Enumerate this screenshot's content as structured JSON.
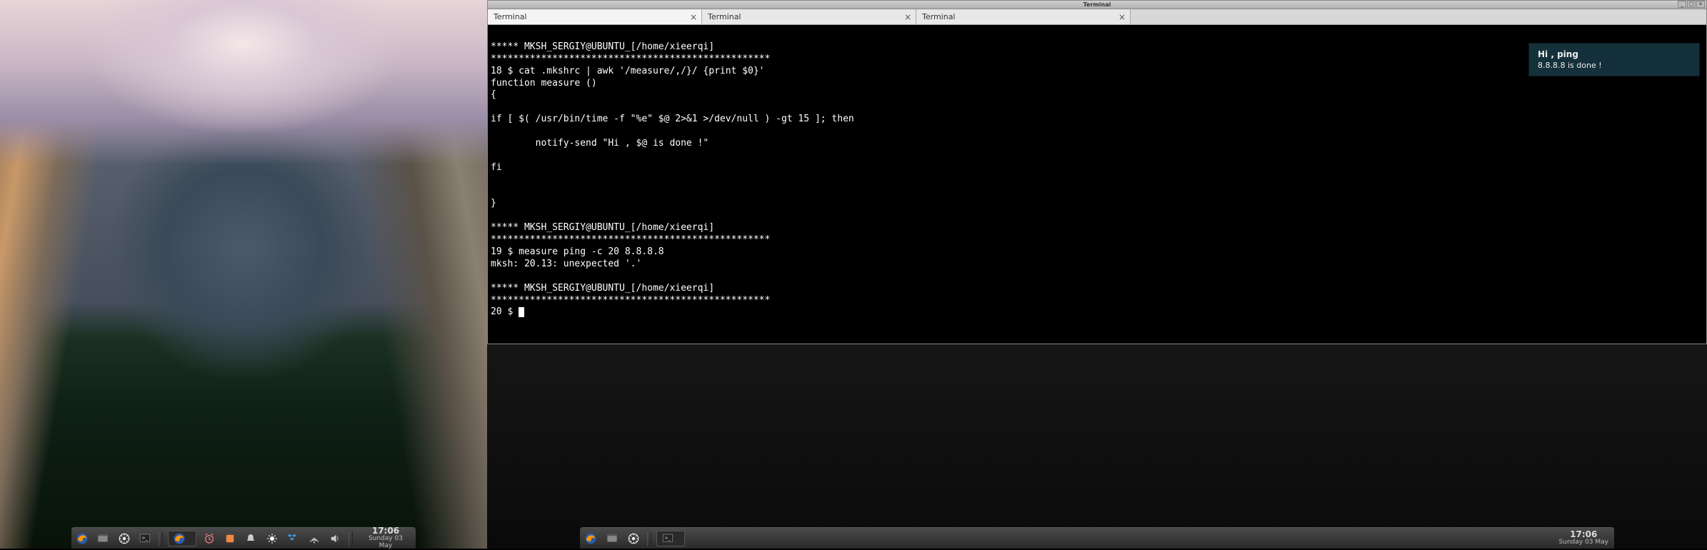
{
  "left": {
    "panel": {
      "launchers": [
        "firefox-icon",
        "files-icon",
        "menu-icon",
        "terminal-icon"
      ],
      "tasks": [
        {
          "icon": "firefox-icon",
          "label": ""
        }
      ],
      "tray_icons": [
        "alarm-icon",
        "media-icon",
        "bell-icon",
        "brightness-icon",
        "dropbox-icon",
        "network-icon",
        "volume-icon"
      ],
      "clock": {
        "time": "17:06",
        "date": "Sunday 03 May"
      }
    }
  },
  "right": {
    "window": {
      "title": "Terminal",
      "controls": [
        "_",
        "□",
        "✕"
      ],
      "tabs": [
        {
          "label": "Terminal",
          "active": true
        },
        {
          "label": "Terminal",
          "active": false
        },
        {
          "label": "Terminal",
          "active": false
        }
      ],
      "lines": [
        "",
        "***** MKSH_SERGIY@UBUNTU_[/home/xieerqi]",
        "**************************************************",
        "18 $ cat .mkshrc | awk '/measure/,/}/ {print $0}'",
        "function measure ()",
        "{",
        "",
        "if [ $( /usr/bin/time -f \"%e\" $@ 2>&1 >/dev/null ) -gt 15 ]; then",
        "",
        "        notify-send \"Hi , $@ is done !\"",
        "",
        "fi",
        "",
        "",
        "}",
        "",
        "***** MKSH_SERGIY@UBUNTU_[/home/xieerqi]",
        "**************************************************",
        "19 $ measure ping -c 20 8.8.8.8",
        "mksh: 20.13: unexpected '.'",
        "",
        "***** MKSH_SERGIY@UBUNTU_[/home/xieerqi]",
        "**************************************************",
        "20 $ "
      ]
    },
    "notification": {
      "title": "Hi , ping",
      "body": "8.8.8.8 is done !"
    },
    "panel": {
      "launchers": [
        "firefox-icon",
        "files-icon",
        "menu-icon"
      ],
      "tasks": [
        {
          "icon": "terminal-icon",
          "label": ""
        }
      ],
      "clock": {
        "time": "17:06",
        "date": "Sunday 03 May"
      }
    }
  }
}
